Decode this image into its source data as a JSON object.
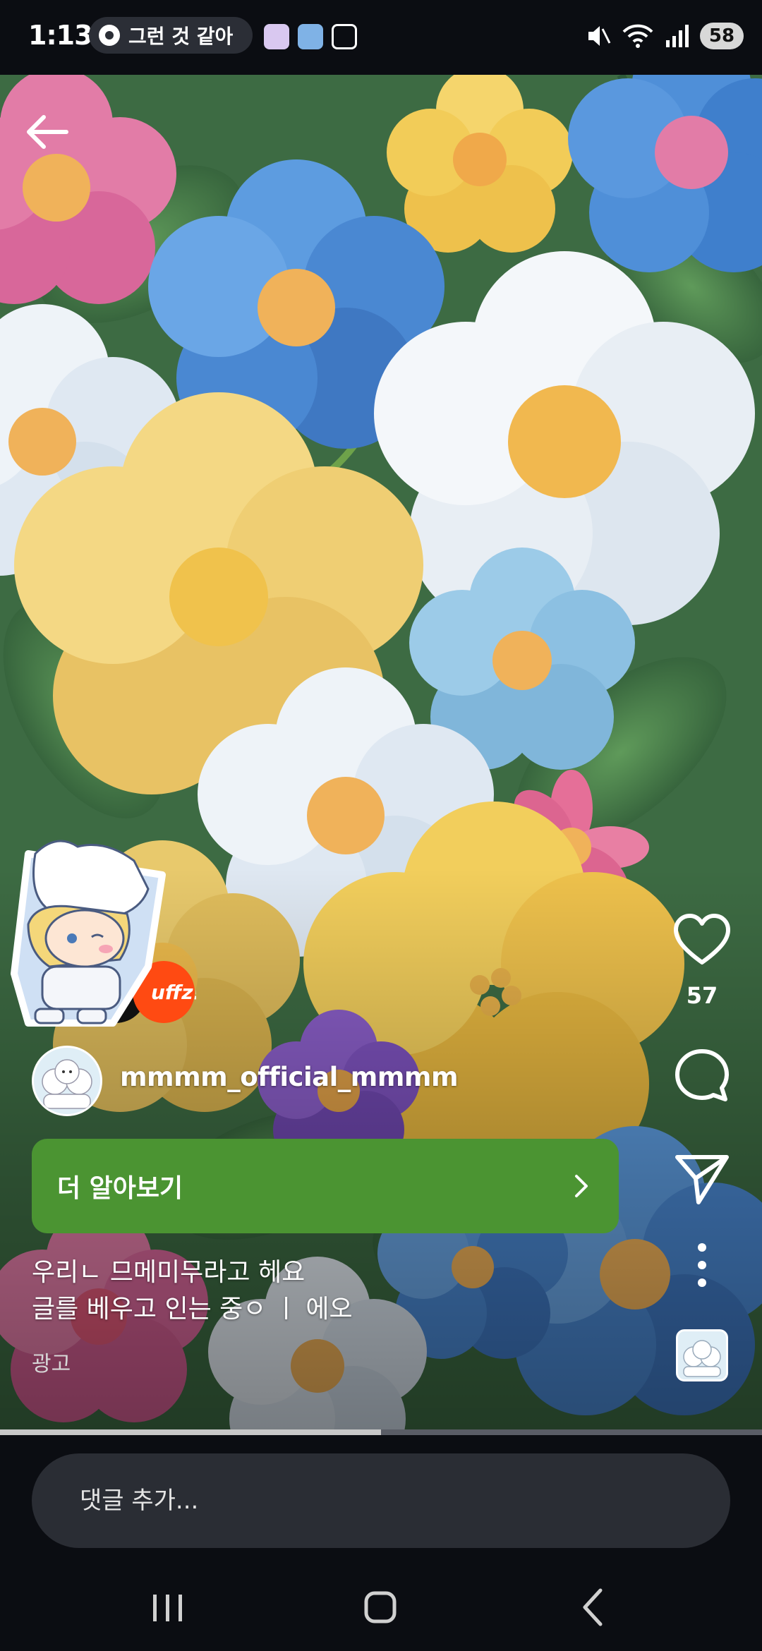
{
  "status_bar": {
    "time": "1:13",
    "now_playing": "그런 것 같아",
    "battery": "58",
    "icons": [
      "mute-icon",
      "wifi-icon",
      "signal-icon",
      "battery-icon"
    ]
  },
  "reel": {
    "like_count": "57",
    "username": "mmmm_official_mmmm",
    "cta_label": "더 알아보기",
    "caption_line1": "우리ㄴ 므메미무라고 헤요",
    "caption_line2": "글를 베우고 인는 중ㅇ ㅣ 에오",
    "ad_label": "광고",
    "brand_text": "uffz!",
    "progress": 0.5
  },
  "comment": {
    "placeholder": "댓글 추가..."
  },
  "colors": {
    "cta": "#4b9432",
    "background": "#0b0d12"
  }
}
